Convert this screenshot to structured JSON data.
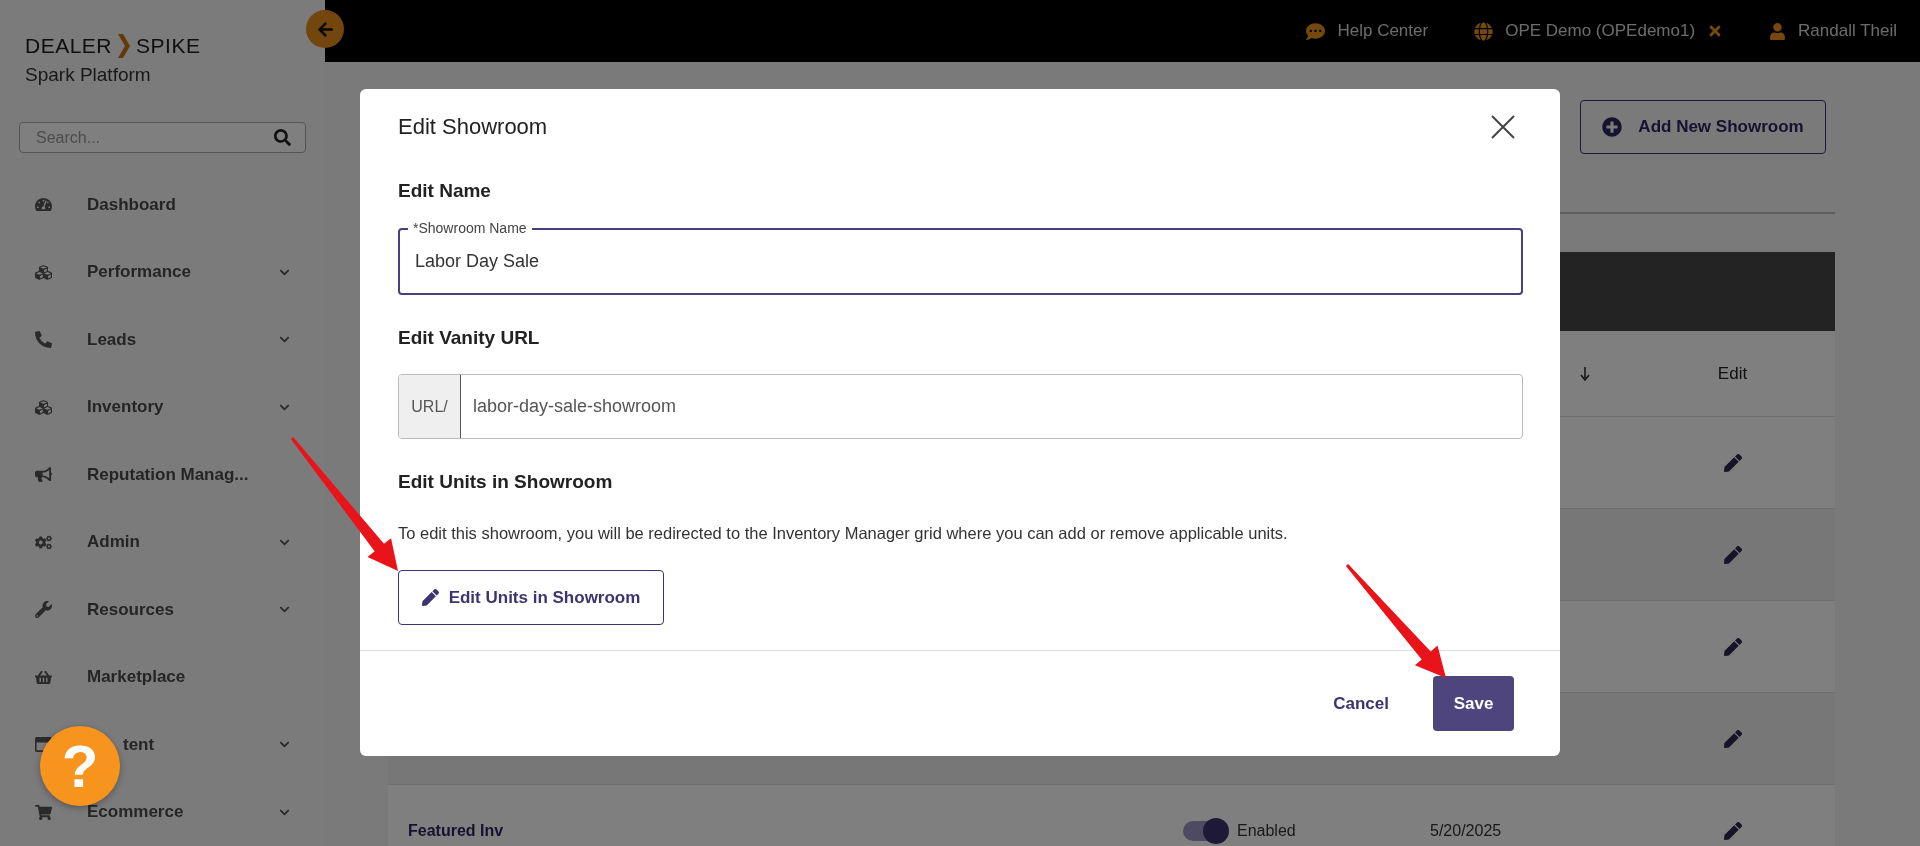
{
  "sidebar": {
    "brand": {
      "left": "DEALER",
      "right": "SPIKE",
      "subtitle": "Spark Platform"
    },
    "search": {
      "placeholder": "Search..."
    },
    "items": [
      {
        "label": "Dashboard",
        "has_submenu": false
      },
      {
        "label": "Performance",
        "has_submenu": true
      },
      {
        "label": "Leads",
        "has_submenu": true
      },
      {
        "label": "Inventory",
        "has_submenu": true
      },
      {
        "label": "Reputation Manag...",
        "has_submenu": false
      },
      {
        "label": "Admin",
        "has_submenu": true
      },
      {
        "label": "Resources",
        "has_submenu": true
      },
      {
        "label": "Marketplace",
        "has_submenu": false
      },
      {
        "label": "tent",
        "has_submenu": true,
        "partly_covered": true
      },
      {
        "label": "Ecommerce",
        "has_submenu": true
      }
    ],
    "help_button": "?"
  },
  "topbar": {
    "help": "Help Center",
    "account": "OPE Demo (OPEdemo1)",
    "user": "Randall Theil"
  },
  "page": {
    "add_button": "Add New Showroom",
    "table": {
      "edit_header": "Edit",
      "rows": [
        {
          "kind": "covered"
        },
        {
          "kind": "covered"
        },
        {
          "kind": "covered"
        },
        {
          "kind": "covered"
        },
        {
          "kind": "full",
          "name": "Featured Inv",
          "enabled": true,
          "status": "Enabled",
          "date": "5/20/2025"
        }
      ]
    }
  },
  "modal": {
    "title": "Edit Showroom",
    "name_heading": "Edit Name",
    "name_field": {
      "label": "*Showroom Name",
      "value": "Labor Day Sale"
    },
    "url_heading": "Edit Vanity URL",
    "url_field": {
      "prefix": "URL/",
      "value": "labor-day-sale-showroom"
    },
    "units_heading": "Edit Units in Showroom",
    "units_text": "To edit this showroom, you will be redirected to the Inventory Manager grid where you can add or remove applicable units.",
    "units_button": "Edit Units in Showroom",
    "cancel": "Cancel",
    "save": "Save"
  }
}
